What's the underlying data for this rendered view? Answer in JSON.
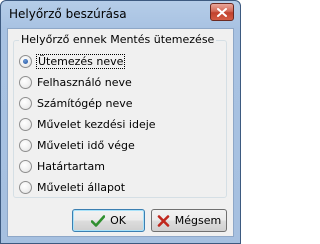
{
  "window": {
    "title": "Helyőrző beszúrása",
    "close_icon": "close-icon"
  },
  "group": {
    "legend": "Helyőrző ennek Mentés ütemezése",
    "options": [
      {
        "label": "Ütemezés neve",
        "checked": true
      },
      {
        "label": "Felhasználó neve",
        "checked": false
      },
      {
        "label": "Számítógép neve",
        "checked": false
      },
      {
        "label": "Művelet kezdési ideje",
        "checked": false
      },
      {
        "label": "Műveleti idő vége",
        "checked": false
      },
      {
        "label": "Határtartam",
        "checked": false
      },
      {
        "label": "Műveleti állapot",
        "checked": false
      }
    ]
  },
  "buttons": {
    "ok_label": "OK",
    "ok_icon": "checkmark-icon",
    "cancel_label": "Mégsem",
    "cancel_icon": "x-mark-icon"
  },
  "colors": {
    "title_bar": "#a8c2e2",
    "ok_icon": "#2f8f2f",
    "cancel_icon": "#c0281e",
    "radio_checked": "#1c4f9e"
  }
}
